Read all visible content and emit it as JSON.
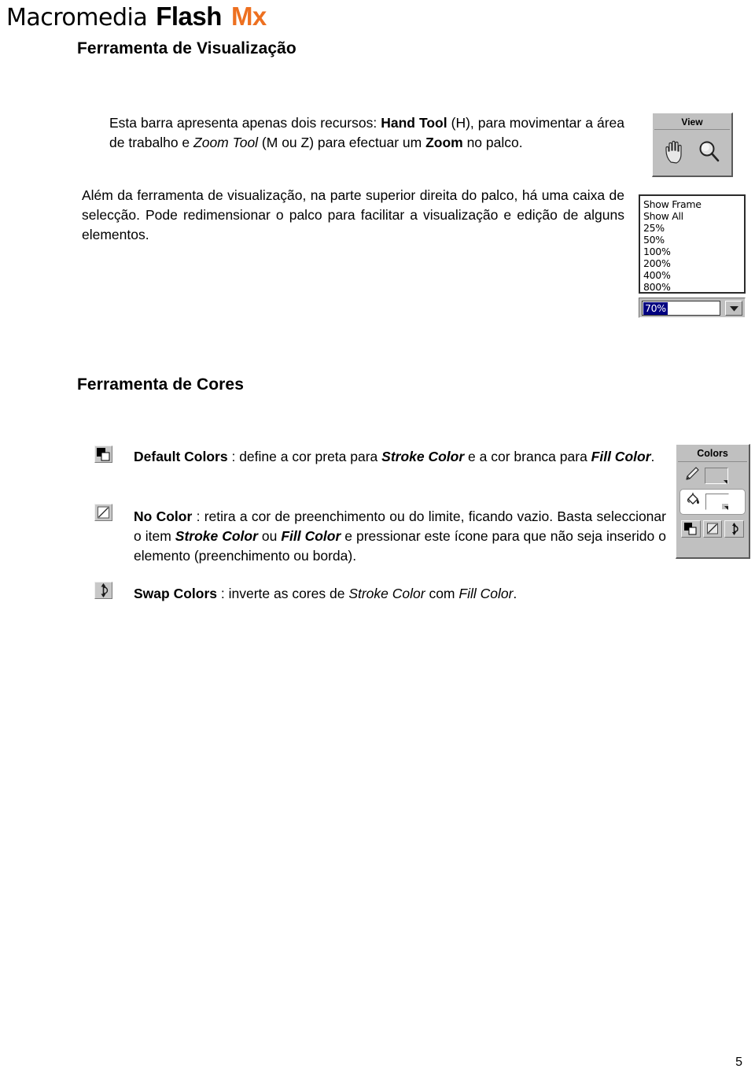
{
  "masthead": {
    "brand_prefix": "Macromedia",
    "brand_name": "Flash",
    "brand_version": "Mx",
    "accent_color": "#ED7020"
  },
  "sections": {
    "visualizacao_heading": "Ferramenta de Visualização",
    "cores_heading": "Ferramenta de Cores"
  },
  "paragraphs": {
    "hand_zoom": {
      "p1": "Esta barra apresenta apenas dois recursos: ",
      "b1": "Hand Tool",
      "p2": " (H), para movimentar a área de trabalho e ",
      "i1": "Zoom Tool",
      "p3": " (M ou Z) para efectuar um ",
      "b2": "Zoom",
      "p4": " no palco."
    },
    "caixa_seleccao": {
      "p1": "Além da ferramenta de visualização, na parte superior direita do palco, há uma caixa de selecção. Pode redimensionar o palco para facilitar a visualização e edição de alguns elementos."
    }
  },
  "view_panel": {
    "title": "View",
    "hand_tool_icon": "hand-tool-icon",
    "zoom_tool_icon": "magnifier-icon"
  },
  "zoom_list": {
    "options": [
      "Show Frame",
      "Show All",
      "25%",
      "50%",
      "100%",
      "200%",
      "400%",
      "800%"
    ],
    "selected_value": "70%",
    "selection_bg": "#000080",
    "arrow_icon": "chevron-down-icon"
  },
  "color_tools": [
    {
      "name": "Default Colors",
      "icon": "default-colors-icon",
      "sep": " : ",
      "desc_1": "define a cor preta para ",
      "em_1": "Stroke Color",
      "desc_2": " e a cor branca para ",
      "em_2": "Fill Color",
      "desc_3": "."
    },
    {
      "name": "No Color",
      "icon": "no-color-icon",
      "sep": " : ",
      "desc_1": "retira a cor de preenchimento ou do limite, ficando vazio. Basta seleccionar o item ",
      "em_1": "Stroke Color",
      "desc_2": " ou ",
      "em_2": "Fill Color",
      "desc_3": " e pressionar este ícone para que não seja inserido o elemento (preenchimento ou borda)."
    },
    {
      "name": "Swap Colors",
      "icon": "swap-colors-icon",
      "sep": " : ",
      "desc_1": "inverte as cores de ",
      "em_1": "Stroke Color",
      "desc_2": " com ",
      "em_2": "Fill Color",
      "desc_3": "."
    }
  ],
  "colors_panel": {
    "title": "Colors",
    "stroke_row": {
      "icon": "pencil-icon",
      "swatch_color": "#000000",
      "label": "stroke-color-swatch"
    },
    "fill_row": {
      "icon": "paint-bucket-icon",
      "swatch_color": "#0A62D0",
      "label": "fill-color-swatch",
      "selected": true
    },
    "buttons": [
      "default-colors-button",
      "no-color-button",
      "swap-colors-button"
    ]
  },
  "footer": {
    "page_number": "5"
  }
}
